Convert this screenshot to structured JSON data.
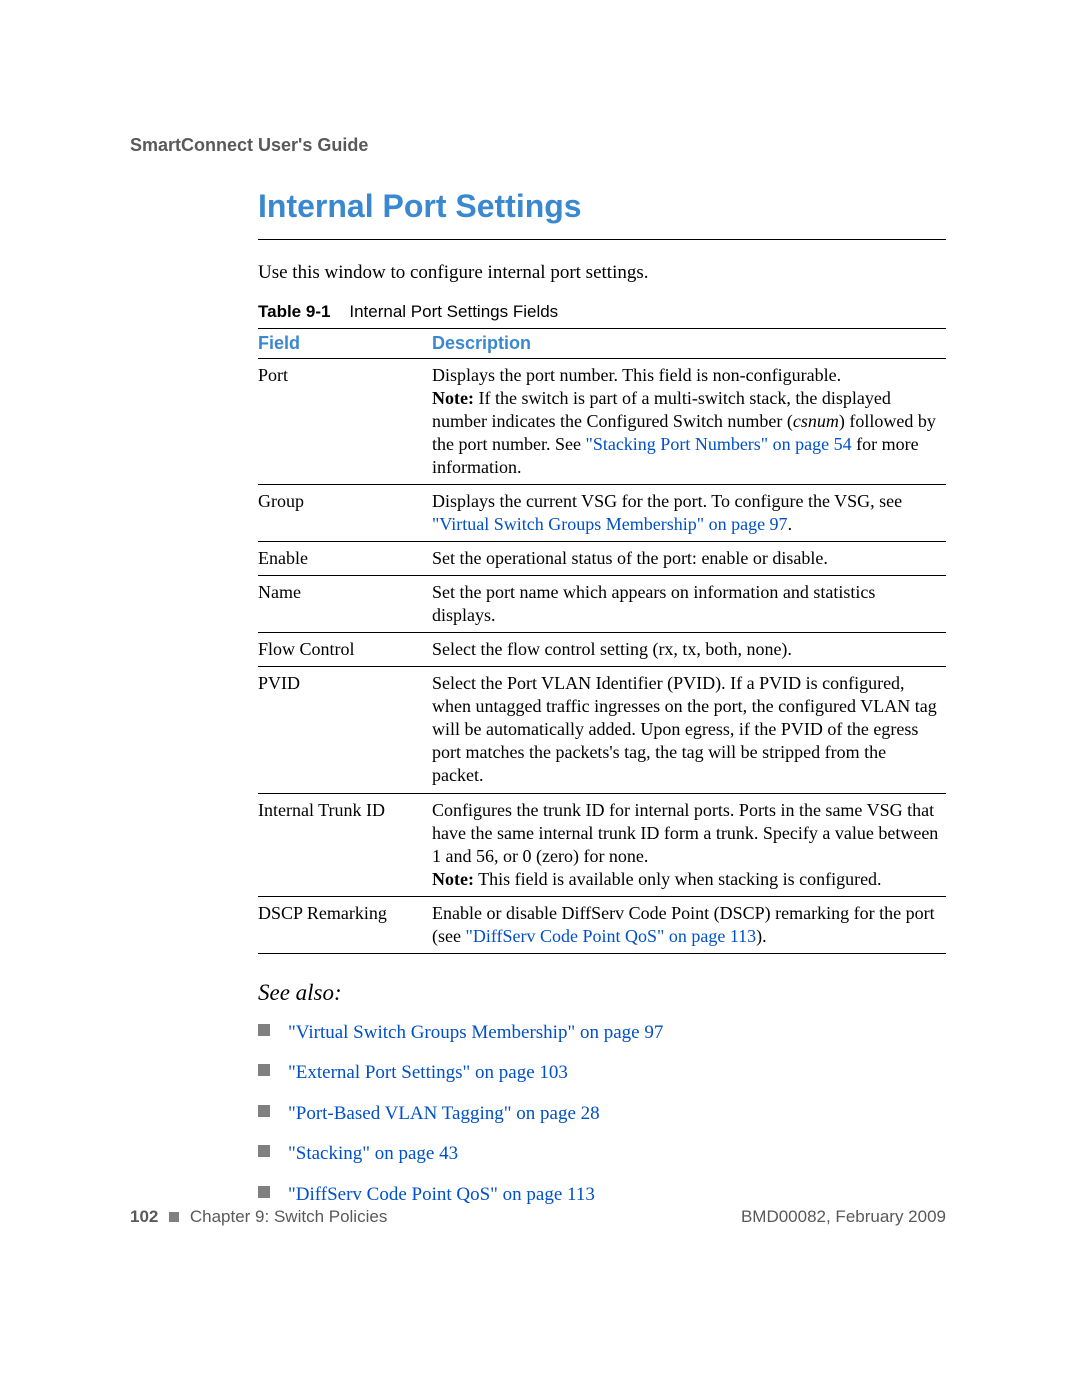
{
  "running_head": "SmartConnect User's Guide",
  "title": "Internal Port Settings",
  "intro": "Use this window to configure internal port settings.",
  "table": {
    "caption_label": "Table 9-1",
    "caption_title": "Internal Port Settings Fields",
    "head_field": "Field",
    "head_desc": "Description",
    "rows": {
      "port": {
        "field": "Port",
        "d1": "Displays the port number. This field is non-configurable.",
        "note_label": "Note:",
        "d2a": " If the switch is part of a multi-switch stack, the displayed number indicates the Configured Switch number (",
        "d2_italic": "csnum",
        "d2b": ") followed by the port number. See ",
        "link": "\"Stacking Port Numbers\" on page 54",
        "d2c": " for more information."
      },
      "group": {
        "field": "Group",
        "d1": "Displays the current VSG for the port. To configure the VSG, see ",
        "link": "\"Virtual Switch Groups Membership\" on page 97",
        "d2": "."
      },
      "enable": {
        "field": "Enable",
        "desc": "Set the operational status of the port: enable or disable."
      },
      "name": {
        "field": "Name",
        "desc": "Set the port name which appears on information and statistics displays."
      },
      "flow": {
        "field": "Flow Control",
        "desc": "Select the flow control setting (rx, tx, both, none)."
      },
      "pvid": {
        "field": "PVID",
        "desc": "Select the Port VLAN Identifier (PVID). If a PVID is configured, when untagged traffic ingresses on the port, the configured VLAN tag will be automatically added. Upon egress, if the PVID of the egress port matches the packets's tag, the tag will be stripped from the packet."
      },
      "trunk": {
        "field": "Internal Trunk ID",
        "d1": "Configures the trunk ID for internal ports. Ports in the same VSG that have the same internal trunk ID form a trunk. Specify a value between 1 and 56, or 0 (zero) for none.",
        "note_label": "Note:",
        "d2": " This field is available only when stacking is configured."
      },
      "dscp": {
        "field": "DSCP Remarking",
        "d1": "Enable or disable DiffServ Code Point (DSCP) remarking for the port (see ",
        "link": "\"DiffServ Code Point QoS\" on page 113",
        "d2": ")."
      }
    }
  },
  "see_also": {
    "heading": "See also:",
    "items": [
      "\"Virtual Switch Groups Membership\" on page 97",
      "\"External Port Settings\" on page 103",
      "\"Port-Based VLAN Tagging\" on page 28",
      "\"Stacking\" on page 43",
      "\"DiffServ Code Point QoS\" on page 113"
    ]
  },
  "footer": {
    "page_num": "102",
    "chapter": "Chapter 9: Switch Policies",
    "doc_id": "BMD00082, February 2009"
  }
}
